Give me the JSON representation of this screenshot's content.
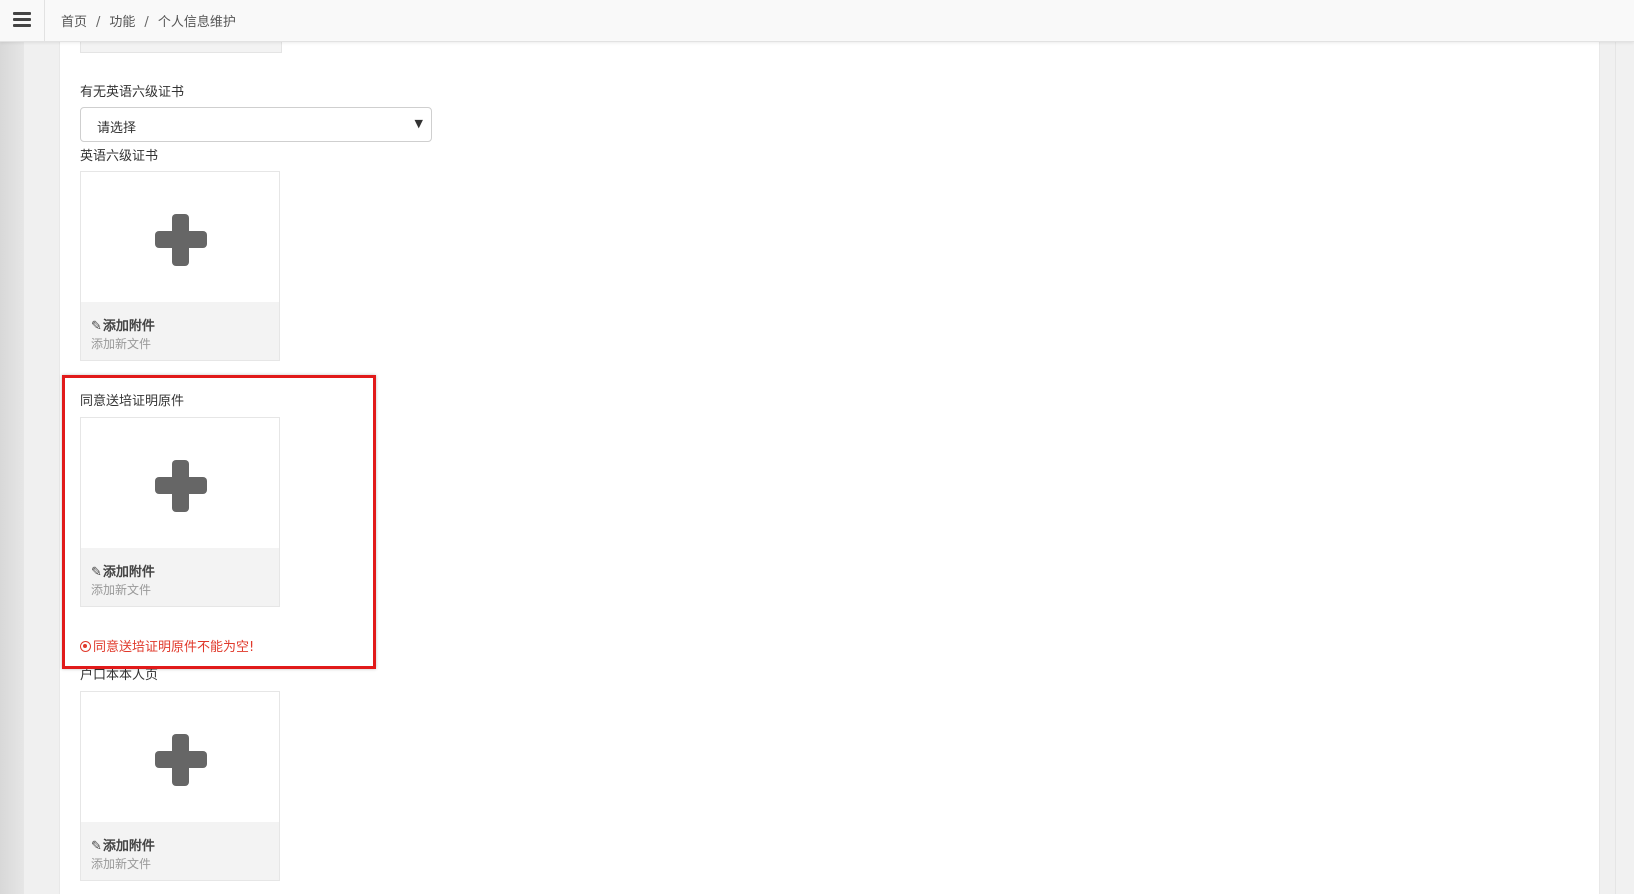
{
  "breadcrumb": {
    "items": [
      "首页",
      "功能",
      "个人信息维护"
    ],
    "separator": "/"
  },
  "form": {
    "cet6_question_label": "有无英语六级证书",
    "cet6_select_value": "请选择",
    "cet6_cert_label": "英语六级证书",
    "consent_label": "同意送培证明原件",
    "consent_error": "同意送培证明原件不能为空!",
    "hukou_label": "户口本本人页",
    "uploader": {
      "title": "添加附件",
      "subtitle": "添加新文件",
      "clip_icon": "✎"
    }
  },
  "colors": {
    "error": "#e0392b",
    "highlight": "#e11a1a",
    "plus": "#666666"
  },
  "icons": {
    "menu": "hamburger-menu-icon",
    "plus": "plus-icon",
    "attach": "paperclip-icon",
    "error": "error-circle-icon",
    "dropdown": "chevron-down-icon"
  }
}
